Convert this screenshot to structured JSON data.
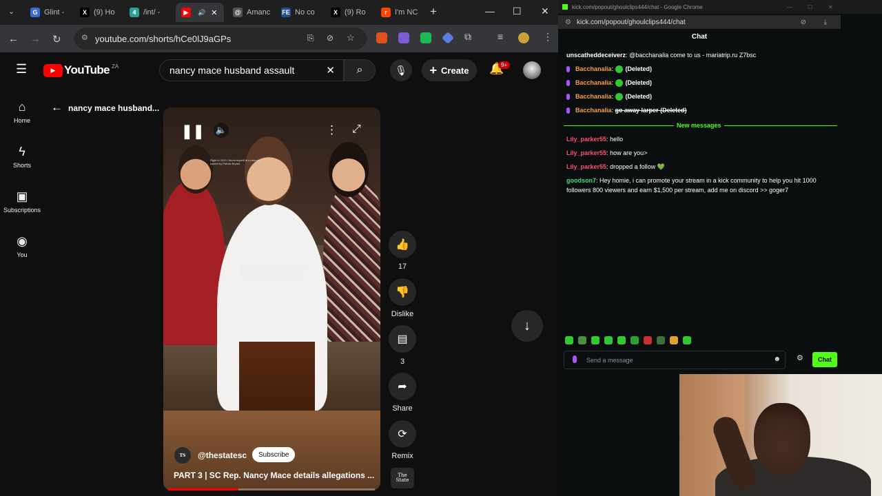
{
  "browser": {
    "tabs": [
      {
        "label": "Glint -",
        "fav_color": "#3a6bd9",
        "fav_char": "G"
      },
      {
        "label": "(9) Ho",
        "fav_color": "#000000",
        "fav_char": "X"
      },
      {
        "label": "/int/ -",
        "fav_color": "#2aa198",
        "fav_char": "4"
      },
      {
        "label": "",
        "fav_color": "#ff0000",
        "fav_char": "▶"
      },
      {
        "label": "Amanc",
        "fav_color": "#555555",
        "fav_char": "@"
      },
      {
        "label": "No co",
        "fav_color": "#1d4f91",
        "fav_char": "FE"
      },
      {
        "label": "(9) Ro",
        "fav_color": "#000000",
        "fav_char": "X"
      },
      {
        "label": "I'm NC",
        "fav_color": "#ff4500",
        "fav_char": "r"
      }
    ],
    "url": "youtube.com/shorts/hCe0lJ9aGPs"
  },
  "youtube": {
    "logo_text": "YouTube",
    "country": "ZA",
    "search_value": "nancy mace husband assault",
    "create_label": "Create",
    "notif_badge": "9+",
    "sidebar": [
      {
        "icon": "home-icon",
        "glyph": "⌂",
        "label": "Home"
      },
      {
        "icon": "shorts-icon",
        "glyph": "ϟ",
        "label": "Shorts"
      },
      {
        "icon": "subscriptions-icon",
        "glyph": "▣",
        "label": "Subscriptions"
      },
      {
        "icon": "you-icon",
        "glyph": "◉",
        "label": "You"
      }
    ],
    "back_title": "nancy mace husband...",
    "video_overlay_text": "Right in 2023 I found myself at a property owned by Patrick Bryant",
    "channel": "@thestatesc",
    "subscribe_label": "Subscribe",
    "caption": "PART 3 | SC Rep. Nancy Mace details allegations ...",
    "channel_logo": "The State",
    "progress": 0.34,
    "rail": {
      "likes": "17",
      "dislike_label": "Dislike",
      "comments": "3",
      "share_label": "Share",
      "remix_label": "Remix"
    }
  },
  "chat": {
    "window_title": "kick.com/popout/ghoulclips444/chat - Google Chrome",
    "url": "kick.com/popout/ghoulclips444/chat",
    "header": "Chat",
    "new_messages_label": "New messages",
    "colors": {
      "accent": "#53fc18",
      "bacchanalia": "#f59e42",
      "lily": "#ff4d6d",
      "goodson": "#4ade80",
      "unscathed": "#ffffff"
    },
    "messages_before": [
      {
        "user": "unscatheddeceiverz",
        "text": "@bacchanalia come to us - mariatrip.ru Z7bsc",
        "color": "#ffffff",
        "mic": false
      },
      {
        "user": "Bacchanalia",
        "text": "(Deleted)",
        "color": "#f59e42",
        "mic": true
      },
      {
        "user": "Bacchanalia",
        "text": "(Deleted)",
        "color": "#f59e42",
        "mic": true
      },
      {
        "user": "Bacchanalia",
        "text": "(Deleted)",
        "color": "#f59e42",
        "mic": true
      },
      {
        "user": "Bacchanalia",
        "text": "go away larper (Deleted)",
        "color": "#f59e42",
        "mic": true
      }
    ],
    "messages_after": [
      {
        "user": "Lily_parker55",
        "text": "hello",
        "color": "#ff4d6d"
      },
      {
        "user": "Lily_parker55",
        "text": "how are you>",
        "color": "#ff4d6d"
      },
      {
        "user": "Lily_parker55",
        "text": "dropped a follow 💚",
        "color": "#ff4d6d"
      },
      {
        "user": "goodson7",
        "text": "Hey homie, i can promote your stream in a kick community to help you hit 1000",
        "color": "#4ade80"
      }
    ],
    "message_continuation": "followers 800 viewers and earn $1,500 per stream, add me on discord >> goger7",
    "input_placeholder": "Send a message",
    "send_label": "Chat"
  }
}
